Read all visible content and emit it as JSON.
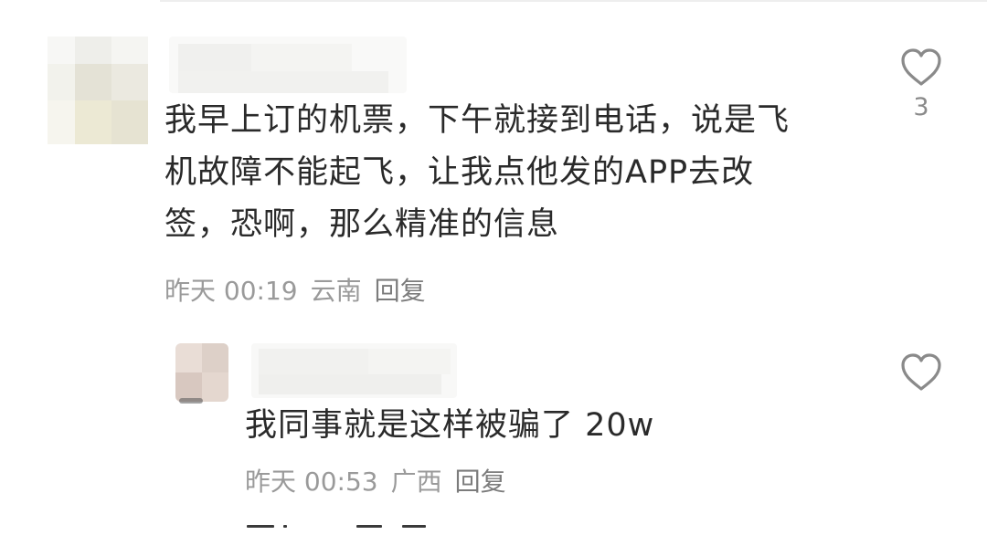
{
  "comments": [
    {
      "text_lines": [
        "我早上订的机票，下午就接到电话，说是飞",
        "机故障不能起飞，让我点他发的APP去改",
        "签，恐啊，那么精准的信息"
      ],
      "time": "昨天 00:19",
      "location": "云南",
      "reply_label": "回复",
      "like_count": "3",
      "like_icon": "heart-outline-icon"
    }
  ],
  "replies": [
    {
      "text": "我同事就是这样被骗了 20w",
      "time": "昨天 00:53",
      "location": "广西",
      "reply_label": "回复",
      "like_icon": "heart-outline-icon"
    }
  ],
  "colors": {
    "text": "#2a2a2a",
    "meta": "#9a9a9a",
    "icon": "#8a8a8a"
  }
}
